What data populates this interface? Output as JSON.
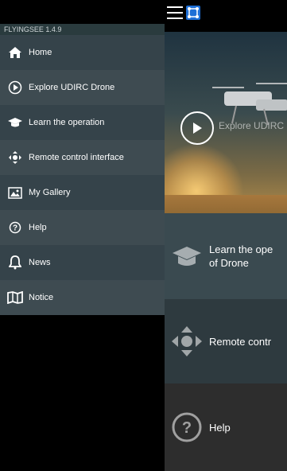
{
  "app": {
    "version": "FLYINGSEE 1.4.9"
  },
  "drawer": {
    "items": [
      {
        "label": "Home",
        "icon": "home-icon"
      },
      {
        "label": "Explore UDIRC Drone",
        "icon": "play-circle-icon"
      },
      {
        "label": "Learn the operation",
        "icon": "graduation-cap-icon"
      },
      {
        "label": "Remote control interface",
        "icon": "dpad-icon"
      },
      {
        "label": "My Gallery",
        "icon": "gallery-icon"
      },
      {
        "label": "Help",
        "icon": "help-icon"
      },
      {
        "label": "News",
        "icon": "bell-icon"
      },
      {
        "label": "Notice",
        "icon": "map-icon"
      }
    ]
  },
  "main": {
    "hero_label": "Explore UDIRC",
    "cards": {
      "learn": "Learn the ope",
      "learn_line2": "of Drone",
      "remote": "Remote contr",
      "help": "Help"
    }
  }
}
